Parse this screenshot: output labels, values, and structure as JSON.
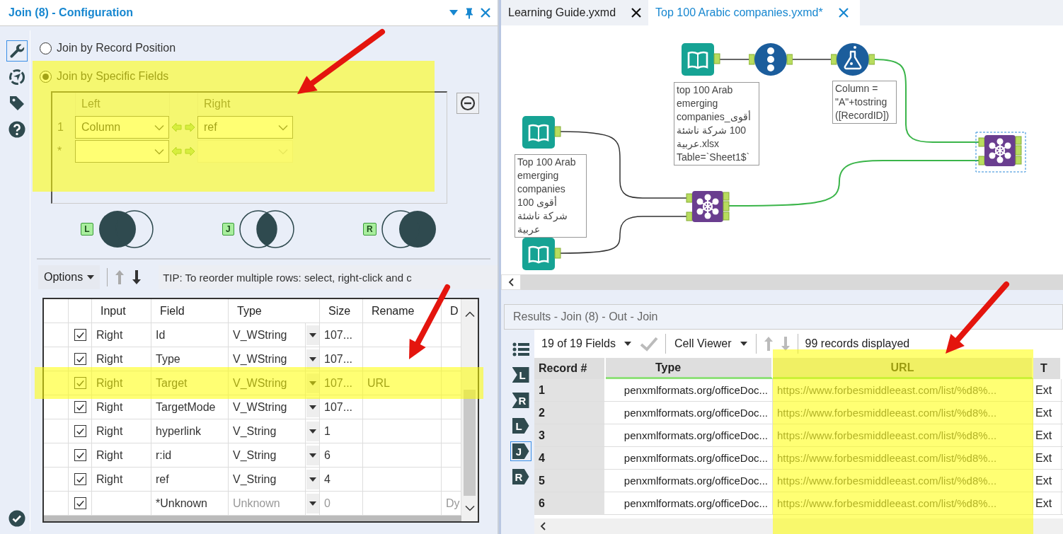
{
  "config_panel": {
    "title": "Join (8) - Configuration",
    "tools": [
      {
        "kind": "wrench",
        "selected": true
      },
      {
        "kind": "compass",
        "selected": false
      },
      {
        "kind": "tag",
        "selected": false
      },
      {
        "kind": "help",
        "selected": false
      }
    ],
    "join_modes": [
      {
        "label": "Join by Record Position",
        "selected": false
      },
      {
        "label": "Join by Specific Fields",
        "selected": true
      }
    ],
    "join_fields": {
      "highlighted": true,
      "columns": [
        "Left",
        "Right"
      ],
      "rows": [
        {
          "index": "1",
          "left": "Column",
          "right": "ref",
          "right_enabled": true
        },
        {
          "index": "*",
          "right_enabled": false
        }
      ]
    },
    "join_outputs": [
      {
        "anchor": "L",
        "kind": "left"
      },
      {
        "anchor": "J",
        "kind": "inner"
      },
      {
        "anchor": "R",
        "kind": "right"
      }
    ],
    "toolbar": {
      "options": "Options",
      "tip": "TIP: To reorder multiple rows: select, right-click and c"
    },
    "fields_table": {
      "columns": [
        "Input",
        "Field",
        "Type",
        "Size",
        "Rename",
        "D"
      ],
      "rows": [
        {
          "checked": true,
          "input": "Right",
          "field": "Id",
          "type": "V_WString",
          "size": "107...",
          "highlighted": false,
          "dimmed": false
        },
        {
          "checked": true,
          "input": "Right",
          "field": "Type",
          "type": "V_WString",
          "size": "107...",
          "highlighted": false,
          "dimmed": false
        },
        {
          "checked": true,
          "input": "Right",
          "field": "Target",
          "type": "V_WString",
          "size": "107...",
          "rename": "URL",
          "highlighted": true,
          "dimmed": false
        },
        {
          "checked": true,
          "input": "Right",
          "field": "TargetMode",
          "type": "V_WString",
          "size": "107...",
          "highlighted": false,
          "dimmed": false
        },
        {
          "checked": true,
          "input": "Right",
          "field": "hyperlink",
          "type": "V_String",
          "size": "1",
          "highlighted": false,
          "dimmed": false
        },
        {
          "checked": true,
          "input": "Right",
          "field": "r:id",
          "type": "V_String",
          "size": "6",
          "highlighted": false,
          "dimmed": false
        },
        {
          "checked": true,
          "input": "Right",
          "field": "ref",
          "type": "V_String",
          "size": "4",
          "highlighted": false,
          "dimmed": false
        },
        {
          "checked": true,
          "field": "*Unknown",
          "type": "Unknown",
          "size": "0",
          "description": "Dy",
          "highlighted": false,
          "dimmed": true
        }
      ]
    }
  },
  "workflow": {
    "tabs": [
      {
        "label": "Learning Guide.yxmd",
        "selected": false
      },
      {
        "label": "Top 100 Arabic companies.yxmd*",
        "selected": true
      }
    ],
    "nodes": [
      {
        "kind": "input",
        "annotation": "top 100 Arab emerging companies_أقوى 100 شركة ناشئة عربية.xlsx Table=`Sheet1$`"
      },
      {
        "kind": "record_id"
      },
      {
        "kind": "formula",
        "annotation": "Column = \"A\"+tostring ([RecordID])"
      },
      {
        "kind": "input",
        "annotation": "Top 100 Arab emerging companies أقوى 100 شركة ناشئة عربية"
      },
      {
        "kind": "join",
        "selected": false
      },
      {
        "kind": "input"
      },
      {
        "kind": "join",
        "selected": true
      }
    ]
  },
  "results": {
    "title": "Results - Join (8) - Out - Join",
    "side_buttons": [
      {
        "kind": "list",
        "selected": false
      },
      {
        "kind": "input",
        "label": "L",
        "selected": false
      },
      {
        "kind": "input",
        "label": "R",
        "selected": false
      },
      {
        "kind": "output",
        "label": "L",
        "selected": false
      },
      {
        "kind": "output",
        "label": "J",
        "selected": true
      },
      {
        "kind": "output",
        "label": "R",
        "selected": false
      }
    ],
    "fields_menu": "19 of 19 Fields",
    "viewer_menu": "Cell Viewer",
    "status": "99 records displayed",
    "table": {
      "columns": [
        {
          "label": "Record #",
          "highlighted": false
        },
        {
          "label": "Type",
          "highlighted": false
        },
        {
          "label": "URL",
          "highlighted": true
        },
        {
          "label": "T",
          "highlighted": false
        }
      ],
      "rows": [
        [
          "1",
          "penxmlformats.org/officeDoc...",
          "https://www.forbesmiddleeast.com/list/%d8%...",
          "Ext"
        ],
        [
          "2",
          "penxmlformats.org/officeDoc...",
          "https://www.forbesmiddleeast.com/list/%d8%...",
          "Ext"
        ],
        [
          "3",
          "penxmlformats.org/officeDoc...",
          "https://www.forbesmiddleeast.com/list/%d8%...",
          "Ext"
        ],
        [
          "4",
          "penxmlformats.org/officeDoc...",
          "https://www.forbesmiddleeast.com/list/%d8%...",
          "Ext"
        ],
        [
          "5",
          "penxmlformats.org/officeDoc...",
          "https://www.forbesmiddleeast.com/list/%d8%...",
          "Ext"
        ],
        [
          "6",
          "penxmlformats.org/officeDoc...",
          "https://www.forbesmiddleeast.com/list/%d8%...",
          "Ext"
        ]
      ]
    }
  }
}
